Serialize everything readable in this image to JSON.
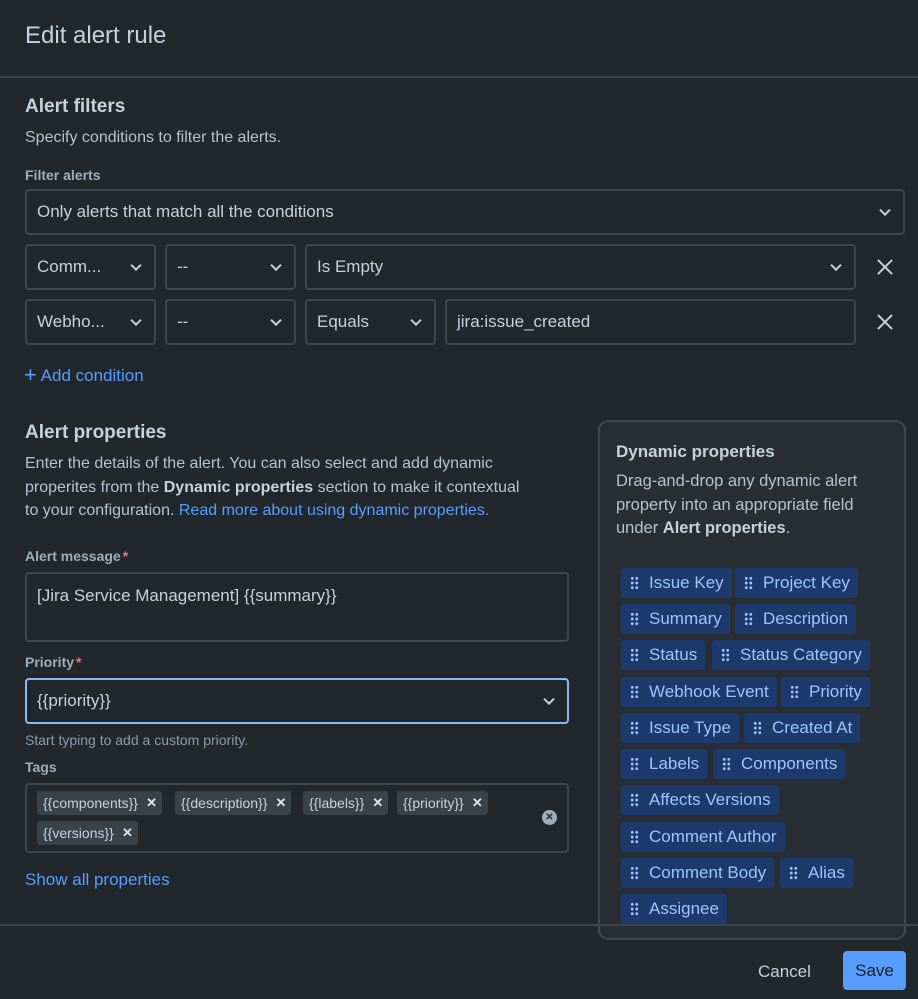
{
  "dialog": {
    "title": "Edit alert rule"
  },
  "filters": {
    "heading": "Alert filters",
    "description": "Specify conditions to filter the alerts.",
    "filter_label": "Filter alerts",
    "filter_mode": "Only alerts that match all the conditions",
    "conditions": [
      {
        "field": "Comm...",
        "subfield": "--",
        "operator": "Is Empty",
        "value": ""
      },
      {
        "field": "Webho...",
        "subfield": "--",
        "operator": "Equals",
        "value": "jira:issue_created"
      }
    ],
    "add_condition": "Add condition"
  },
  "properties": {
    "heading": "Alert properties",
    "desc_part1": "Enter the details of the alert. You can also select and add dynamic",
    "desc_part2a": "properites from the ",
    "desc_part2b": "Dynamic properties",
    "desc_part2c": " section to make it contextual",
    "desc_part3": "to your configuration. ",
    "desc_link": "Read more about using dynamic properties.",
    "message_label": "Alert message",
    "message_value": "[Jira Service Management] {{summary}}",
    "priority_label": "Priority",
    "priority_value": "{{priority}}",
    "priority_hint": "Start typing to add a custom priority.",
    "tags_label": "Tags",
    "tags": [
      "{{components}}",
      "{{description}}",
      "{{labels}}",
      "{{priority}}",
      "{{versions}}"
    ],
    "show_all": "Show all properties",
    "required_mark": "*"
  },
  "dynamic": {
    "heading": "Dynamic properties",
    "desc1": "Drag-and-drop any dynamic alert",
    "desc2": "property into an appropriate field",
    "desc3a": "under ",
    "desc3b": "Alert properties",
    "desc3c": ".",
    "chips": [
      "Issue Key",
      "Project Key",
      "Summary",
      "Description",
      "Status",
      "Status Category",
      "Webhook Event",
      "Priority",
      "Issue Type",
      "Created At",
      "Labels",
      "Components",
      "Affects Versions",
      "Comment Author",
      "Comment Body",
      "Alias",
      "Assignee"
    ]
  },
  "footer": {
    "cancel": "Cancel",
    "save": "Save"
  },
  "colors": {
    "accent": "#579dff",
    "chip_bg": "#1c3a6b",
    "required": "#f87168"
  }
}
